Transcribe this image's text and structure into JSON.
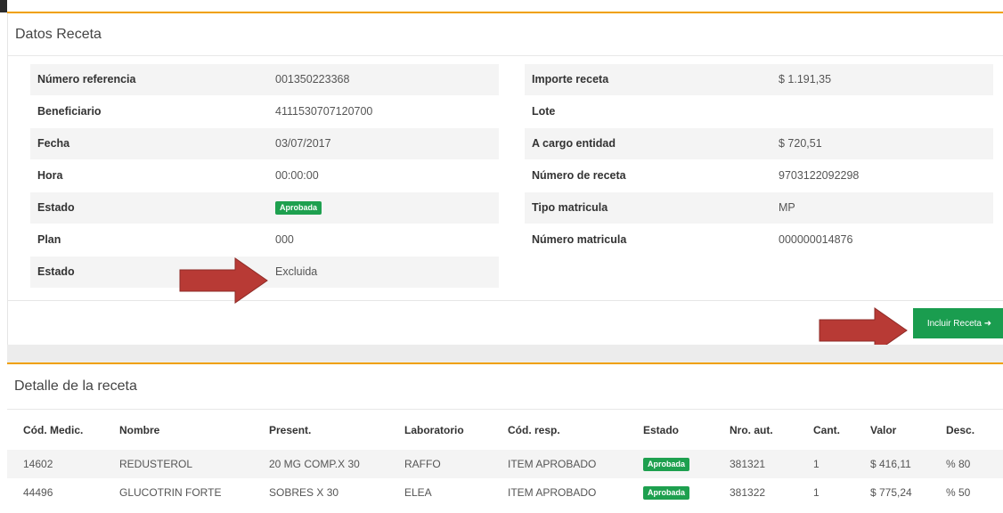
{
  "datos": {
    "title": "Datos Receta",
    "left": [
      {
        "key": "Número referencia",
        "value": "001350223368"
      },
      {
        "key": "Beneficiario",
        "value": "4111530707120700"
      },
      {
        "key": "Fecha",
        "value": "03/07/2017"
      },
      {
        "key": "Hora",
        "value": "00:00:00"
      },
      {
        "key": "Estado",
        "value": "Aprobada"
      },
      {
        "key": "Plan",
        "value": "000"
      },
      {
        "key": "Estado",
        "value": "Excluida"
      }
    ],
    "right": [
      {
        "key": "Importe receta",
        "value": "$ 1.191,35"
      },
      {
        "key": "Lote",
        "value": ""
      },
      {
        "key": "A cargo entidad",
        "value": "$ 720,51"
      },
      {
        "key": "Número de receta",
        "value": "9703122092298"
      },
      {
        "key": "Tipo matricula",
        "value": "MP"
      },
      {
        "key": "Número matricula",
        "value": "000000014876"
      }
    ],
    "incluir_button": "Incluir Receta ➜"
  },
  "detalle": {
    "title": "Detalle de la receta",
    "headers": [
      "Cód. Medic.",
      "Nombre",
      "Present.",
      "Laboratorio",
      "Cód. resp.",
      "Estado",
      "Nro. aut.",
      "Cant.",
      "Valor",
      "Desc."
    ],
    "rows": [
      [
        "14602",
        "REDUSTEROL",
        "20 MG COMP.X 30",
        "RAFFO",
        "ITEM APROBADO",
        "Aprobada",
        "381321",
        "1",
        "$ 416,11",
        "% 80"
      ],
      [
        "44496",
        "GLUCOTRIN FORTE",
        "SOBRES X 30",
        "ELEA",
        "ITEM APROBADO",
        "Aprobada",
        "381322",
        "1",
        "$ 775,24",
        "% 50"
      ]
    ]
  },
  "colors": {
    "accent": "#f0a000",
    "success": "#1ea04f",
    "excluded": "#f08a4b",
    "arrow": "#c0392b"
  }
}
